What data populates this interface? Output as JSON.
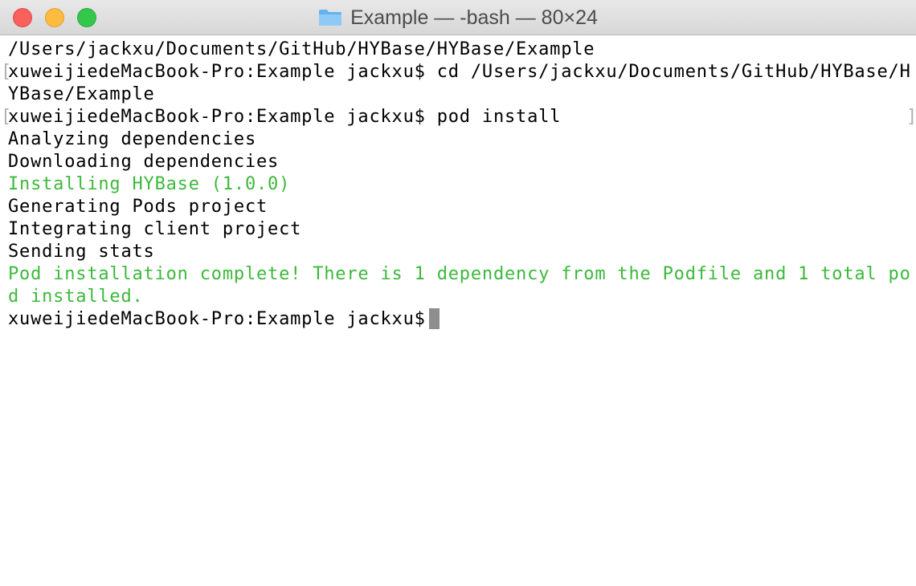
{
  "window": {
    "title": "Example — -bash — 80×24",
    "icon": "folder-icon"
  },
  "colors": {
    "text": "#000000",
    "success": "#3cb93c",
    "background": "#ffffff",
    "close": "#fc605c",
    "minimize": "#fdbc40",
    "zoom": "#34c84a"
  },
  "terminal": {
    "lines": [
      {
        "text": "/Users/jackxu/Documents/GitHub/HYBase/HYBase/Example",
        "color": "normal"
      },
      {
        "text": "xuweijiedeMacBook-Pro:Example jackxu$ cd /Users/jackxu/Documents/GitHub/HYBase/H",
        "color": "normal"
      },
      {
        "text": "YBase/Example",
        "color": "normal"
      },
      {
        "text": "xuweijiedeMacBook-Pro:Example jackxu$ pod install",
        "color": "normal"
      },
      {
        "text": "Analyzing dependencies",
        "color": "normal"
      },
      {
        "text": "Downloading dependencies",
        "color": "normal"
      },
      {
        "text": "Installing HYBase (1.0.0)",
        "color": "green"
      },
      {
        "text": "Generating Pods project",
        "color": "normal"
      },
      {
        "text": "Integrating client project",
        "color": "normal"
      },
      {
        "text": "Sending stats",
        "color": "normal"
      },
      {
        "text": "Pod installation complete! There is 1 dependency from the Podfile and 1 total po",
        "color": "green"
      },
      {
        "text": "d installed.",
        "color": "green"
      }
    ],
    "prompt": "xuweijiedeMacBook-Pro:Example jackxu$"
  }
}
